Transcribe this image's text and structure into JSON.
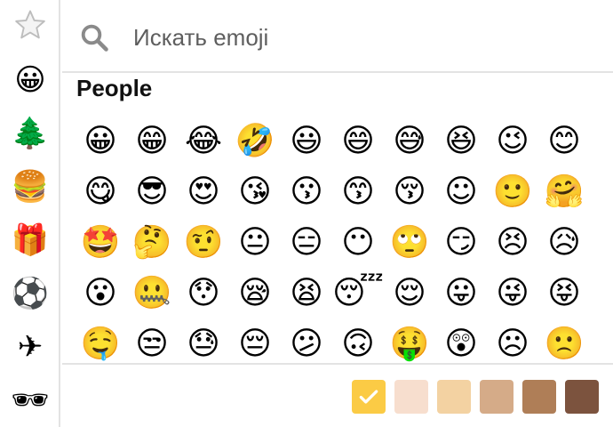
{
  "sidebar": {
    "categories": [
      {
        "name": "recent",
        "icon": "star-icon",
        "glyph": "☆"
      },
      {
        "name": "people",
        "icon": "smiley-icon",
        "glyph": "😀"
      },
      {
        "name": "nature",
        "icon": "tree-icon",
        "glyph": "🌲"
      },
      {
        "name": "food",
        "icon": "hamburger-icon",
        "glyph": "🍔"
      },
      {
        "name": "objects",
        "icon": "gift-icon",
        "glyph": "🎁"
      },
      {
        "name": "sports",
        "icon": "soccer-ball-icon",
        "glyph": "⚽"
      },
      {
        "name": "travel",
        "icon": "airplane-icon",
        "glyph": "✈"
      },
      {
        "name": "symbols",
        "icon": "sunglasses-icon",
        "glyph": "🕶"
      }
    ]
  },
  "search": {
    "placeholder": "Искать emoji",
    "icon": "search-icon"
  },
  "section": {
    "title": "People"
  },
  "emojis": [
    "😀",
    "😁",
    "😂",
    "🤣",
    "😃",
    "😄",
    "😅",
    "😆",
    "😉",
    "😊",
    "😋",
    "😎",
    "😍",
    "😘",
    "😗",
    "😙",
    "😚",
    "☺",
    "🙂",
    "🤗",
    "🤩",
    "🤔",
    "🤨",
    "😐",
    "😑",
    "😶",
    "🙄",
    "😏",
    "😣",
    "😥",
    "😮",
    "🤐",
    "😯",
    "😪",
    "😫",
    "😴",
    "😌",
    "😛",
    "😜",
    "😝",
    "🤤",
    "😒",
    "😓",
    "😔",
    "😕",
    "🙃",
    "🤑",
    "😲",
    "☹",
    "🙁"
  ],
  "skin_tones": {
    "selected_index": 0,
    "colors": [
      "#FBCB45",
      "#F7DECE",
      "#F3D2A2",
      "#D5AB88",
      "#AF7E57",
      "#7C533E"
    ]
  }
}
